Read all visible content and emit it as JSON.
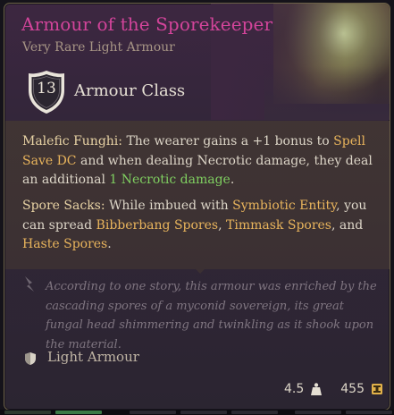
{
  "item": {
    "name": "Armour of the Sporekeeper",
    "rarity_type": "Very Rare Light Armour",
    "armour_class_value": "13",
    "armour_class_label": "Armour Class",
    "ability1": {
      "name": "Malefic Funghi:",
      "text_a": " The wearer gains a +1 bonus to ",
      "link_a": "Spell Save DC",
      "text_b": " and when dealing Necrotic damage, they deal an additional ",
      "damage": "1 Necrotic damage",
      "text_c": "."
    },
    "ability2": {
      "name": "Spore Sacks:",
      "text_a": " While imbued with ",
      "link_a": "Symbiotic Entity",
      "text_b": ", you can spread ",
      "link_b": "Bibberbang Spores",
      "text_c": ", ",
      "link_c": "Timmask Spores",
      "text_d": ", and ",
      "link_d": "Haste Spores",
      "text_e": "."
    },
    "lore": "According to one story, this armour was enriched by the cascading spores of a myconid sovereign, its great fungal head shimmering and twinkling as it shook upon the material.",
    "category": "Light Armour",
    "weight": "4.5",
    "value": "455"
  },
  "colors": {
    "title": "#d2449a",
    "highlight": "#e8b45c",
    "damage": "#7fcf60"
  },
  "icons": {
    "shield": "shield-icon",
    "lore": "quill-icon",
    "armour_type": "light-armour-icon",
    "weight": "weight-icon",
    "gold": "gold-coin-icon"
  }
}
